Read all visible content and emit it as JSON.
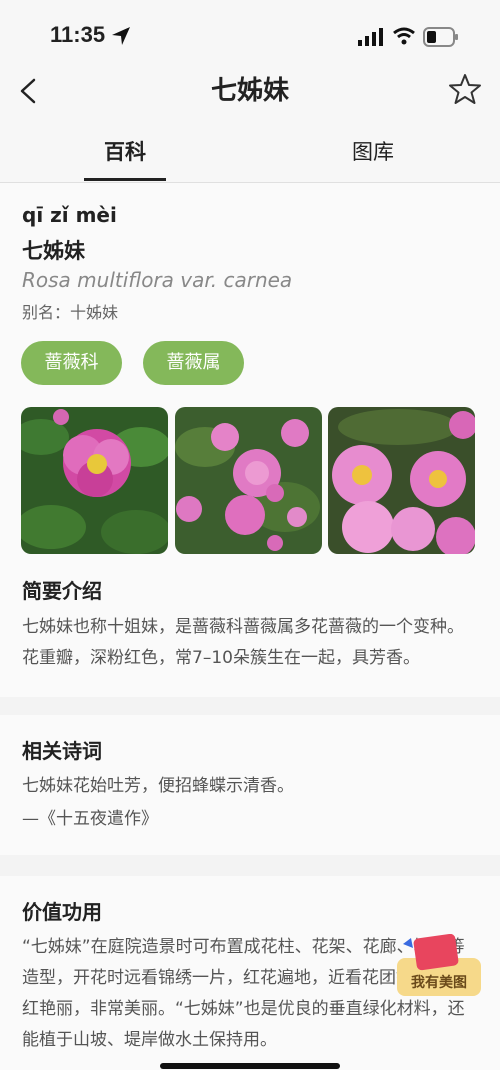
{
  "status": {
    "time": "11:35"
  },
  "nav": {
    "title": "七姊妹"
  },
  "tabs": [
    {
      "label": "百科"
    },
    {
      "label": "图库"
    }
  ],
  "intro": {
    "pinyin": "qī zǐ mèi",
    "name": "七姊妹",
    "latin": "Rosa multiflora var. carnea",
    "alias": "别名：十姊妹",
    "tags": [
      {
        "label": "蔷薇科"
      },
      {
        "label": "蔷薇属"
      }
    ]
  },
  "sections": [
    {
      "title": "简要介绍",
      "text": "七姊妹也称十姐妹，是蔷薇科蔷薇属多花蔷薇的一个变种。花重瓣，深粉红色，常7–10朵簇生在一起，具芳香。"
    },
    {
      "title": "相关诗词",
      "line1": "七姊妹花始吐芳，便招蜂蝶示清香。",
      "line2": "—《十五夜遣作》"
    },
    {
      "title": "价值功用",
      "text": "“七姊妹”在庭院造景时可布置成花柱、花架、花廊、墙垣等造型，开花时远看锦绣一片，红花遍地，近看花团锦簇，鲜红艳丽，非常美丽。“七姊妹”也是优良的垂直绿化材料，还能植于山坡、堤岸做水土保持用。"
    }
  ],
  "badge": {
    "label": "我有美图"
  },
  "colors": {
    "tag_green": "#84b85a",
    "background": "#f3f3f3"
  }
}
